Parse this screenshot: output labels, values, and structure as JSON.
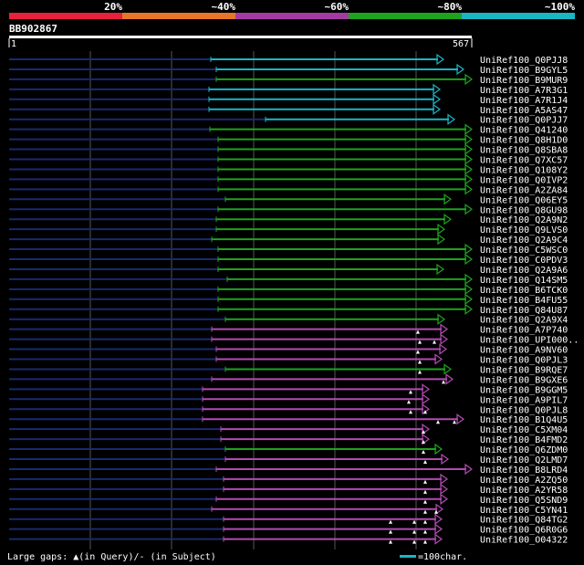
{
  "query": {
    "id": "BB902867",
    "start": "1",
    "end": "567"
  },
  "identity_bar": {
    "labels": [
      "20%",
      "~40%",
      "~60%",
      "~80%",
      "~100%"
    ],
    "colors": [
      "#e8203a",
      "#e8762a",
      "#a23ca2",
      "#1fa31f",
      "#19b6c4"
    ]
  },
  "colors": {
    "cyan": "#19b6c4",
    "green": "#1fa31f",
    "magenta": "#b24bb2",
    "unaligned": "#1a2a70",
    "grid": "#555555"
  },
  "hits": [
    {
      "name": "UniRef100_Q0PJJ8",
      "color": "cyan"
    },
    {
      "name": "UniRef100_B9GYL5",
      "color": "cyan"
    },
    {
      "name": "UniRef100_B9MUR9",
      "color": "green"
    },
    {
      "name": "UniRef100_A7R3G1",
      "color": "cyan"
    },
    {
      "name": "UniRef100_A7R1J4",
      "color": "cyan"
    },
    {
      "name": "UniRef100_A5AS47",
      "color": "cyan"
    },
    {
      "name": "UniRef100_Q0PJJ7",
      "color": "cyan"
    },
    {
      "name": "UniRef100_Q41240",
      "color": "green"
    },
    {
      "name": "UniRef100_Q8H1D0",
      "color": "green"
    },
    {
      "name": "UniRef100_Q8SBA8",
      "color": "green"
    },
    {
      "name": "UniRef100_Q7XC57",
      "color": "green"
    },
    {
      "name": "UniRef100_Q108Y2",
      "color": "green"
    },
    {
      "name": "UniRef100_Q0IVP2",
      "color": "green"
    },
    {
      "name": "UniRef100_A2ZA84",
      "color": "green"
    },
    {
      "name": "UniRef100_Q06EY5",
      "color": "green"
    },
    {
      "name": "UniRef100_Q8GU98",
      "color": "green"
    },
    {
      "name": "UniRef100_Q2A9N2",
      "color": "green"
    },
    {
      "name": "UniRef100_Q9LVS0",
      "color": "green"
    },
    {
      "name": "UniRef100_Q2A9C4",
      "color": "green"
    },
    {
      "name": "UniRef100_C5WSC0",
      "color": "green"
    },
    {
      "name": "UniRef100_C0PDV3",
      "color": "green"
    },
    {
      "name": "UniRef100_Q2A9A6",
      "color": "green"
    },
    {
      "name": "UniRef100_Q14SM5",
      "color": "green"
    },
    {
      "name": "UniRef100_B6TCK0",
      "color": "green"
    },
    {
      "name": "UniRef100_B4FU55",
      "color": "green"
    },
    {
      "name": "UniRef100_Q84U87",
      "color": "green"
    },
    {
      "name": "UniRef100_Q2A9X4",
      "color": "green"
    },
    {
      "name": "UniRef100_A7P740",
      "color": "magenta"
    },
    {
      "name": "UniRef100_UPI000..",
      "color": "magenta"
    },
    {
      "name": "UniRef100_A9NV60",
      "color": "magenta"
    },
    {
      "name": "UniRef100_Q0PJL3",
      "color": "magenta"
    },
    {
      "name": "UniRef100_B9RQE7",
      "color": "green"
    },
    {
      "name": "UniRef100_B9GXE6",
      "color": "magenta"
    },
    {
      "name": "UniRef100_B9GGM5",
      "color": "magenta"
    },
    {
      "name": "UniRef100_A9PIL7",
      "color": "magenta"
    },
    {
      "name": "UniRef100_Q0PJL8",
      "color": "magenta"
    },
    {
      "name": "UniRef100_B1Q4U5",
      "color": "magenta"
    },
    {
      "name": "UniRef100_C5XM04",
      "color": "magenta"
    },
    {
      "name": "UniRef100_B4FMD2",
      "color": "magenta"
    },
    {
      "name": "UniRef100_Q6ZDM0",
      "color": "green"
    },
    {
      "name": "UniRef100_Q2LMD7",
      "color": "magenta"
    },
    {
      "name": "UniRef100_B8LRD4",
      "color": "magenta"
    },
    {
      "name": "UniRef100_A2ZQ50",
      "color": "magenta"
    },
    {
      "name": "UniRef100_A2YR58",
      "color": "magenta"
    },
    {
      "name": "UniRef100_Q5SND9",
      "color": "magenta"
    },
    {
      "name": "UniRef100_C5YN41",
      "color": "magenta"
    },
    {
      "name": "UniRef100_Q84TG2",
      "color": "magenta"
    },
    {
      "name": "UniRef100_Q6R0G6",
      "color": "magenta"
    },
    {
      "name": "UniRef100_O04322",
      "color": "magenta"
    }
  ],
  "footer": {
    "legend": "Large gaps: ▲(in Query)/- (in Subject)",
    "scale": "=100char."
  }
}
